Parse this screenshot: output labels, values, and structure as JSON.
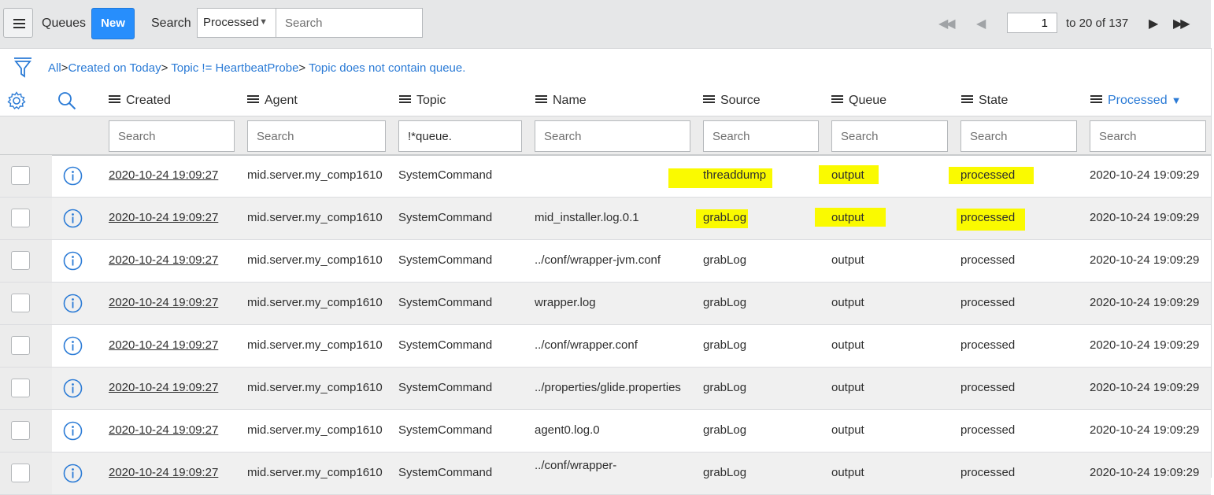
{
  "toolbar": {
    "title": "Queues",
    "new_label": "New",
    "search_label": "Search",
    "search_field": "Processed",
    "search_placeholder": "Search",
    "page_current": "1",
    "page_range": "to 20 of 137"
  },
  "breadcrumb": {
    "items": [
      "All",
      "Created on Today",
      "Topic != HeartbeatProbe",
      "Topic does not contain queue."
    ]
  },
  "columns": [
    {
      "key": "created",
      "label": "Created",
      "filter": ""
    },
    {
      "key": "agent",
      "label": "Agent",
      "filter": ""
    },
    {
      "key": "topic",
      "label": "Topic",
      "filter": "!*queue."
    },
    {
      "key": "name",
      "label": "Name",
      "filter": ""
    },
    {
      "key": "source",
      "label": "Source",
      "filter": ""
    },
    {
      "key": "queue",
      "label": "Queue",
      "filter": ""
    },
    {
      "key": "state",
      "label": "State",
      "filter": ""
    },
    {
      "key": "processed",
      "label": "Processed",
      "filter": "",
      "sorted": "descending"
    }
  ],
  "filter_placeholder": "Search",
  "rows": [
    {
      "created": "2020-10-24 19:09:27",
      "agent": "mid.server.my_comp1610",
      "topic": "SystemCommand",
      "name": "",
      "source": "threaddump",
      "queue": "output",
      "state": "processed",
      "processed": "2020-10-24 19:09:29",
      "highlight": true
    },
    {
      "created": "2020-10-24 19:09:27",
      "agent": "mid.server.my_comp1610",
      "topic": "SystemCommand",
      "name": "mid_installer.log.0.1",
      "source": "grabLog",
      "queue": "output",
      "state": "processed",
      "processed": "2020-10-24 19:09:29",
      "highlight": true
    },
    {
      "created": "2020-10-24 19:09:27",
      "agent": "mid.server.my_comp1610",
      "topic": "SystemCommand",
      "name": "../conf/wrapper-jvm.conf",
      "source": "grabLog",
      "queue": "output",
      "state": "processed",
      "processed": "2020-10-24 19:09:29"
    },
    {
      "created": "2020-10-24 19:09:27",
      "agent": "mid.server.my_comp1610",
      "topic": "SystemCommand",
      "name": "wrapper.log",
      "source": "grabLog",
      "queue": "output",
      "state": "processed",
      "processed": "2020-10-24 19:09:29"
    },
    {
      "created": "2020-10-24 19:09:27",
      "agent": "mid.server.my_comp1610",
      "topic": "SystemCommand",
      "name": "../conf/wrapper.conf",
      "source": "grabLog",
      "queue": "output",
      "state": "processed",
      "processed": "2020-10-24 19:09:29"
    },
    {
      "created": "2020-10-24 19:09:27",
      "agent": "mid.server.my_comp1610",
      "topic": "SystemCommand",
      "name": "../properties/glide.properties",
      "source": "grabLog",
      "queue": "output",
      "state": "processed",
      "processed": "2020-10-24 19:09:29"
    },
    {
      "created": "2020-10-24 19:09:27",
      "agent": "mid.server.my_comp1610",
      "topic": "SystemCommand",
      "name": "agent0.log.0",
      "source": "grabLog",
      "queue": "output",
      "state": "processed",
      "processed": "2020-10-24 19:09:29"
    },
    {
      "created": "2020-10-24 19:09:27",
      "agent": "mid.server.my_comp1610",
      "topic": "SystemCommand",
      "name": "../conf/wrapper-",
      "source": "grabLog",
      "queue": "output",
      "state": "processed",
      "processed": "2020-10-24 19:09:29"
    }
  ],
  "colors": {
    "accent": "#278efc",
    "link": "#2b7bd6",
    "highlight": "#fafa00"
  }
}
